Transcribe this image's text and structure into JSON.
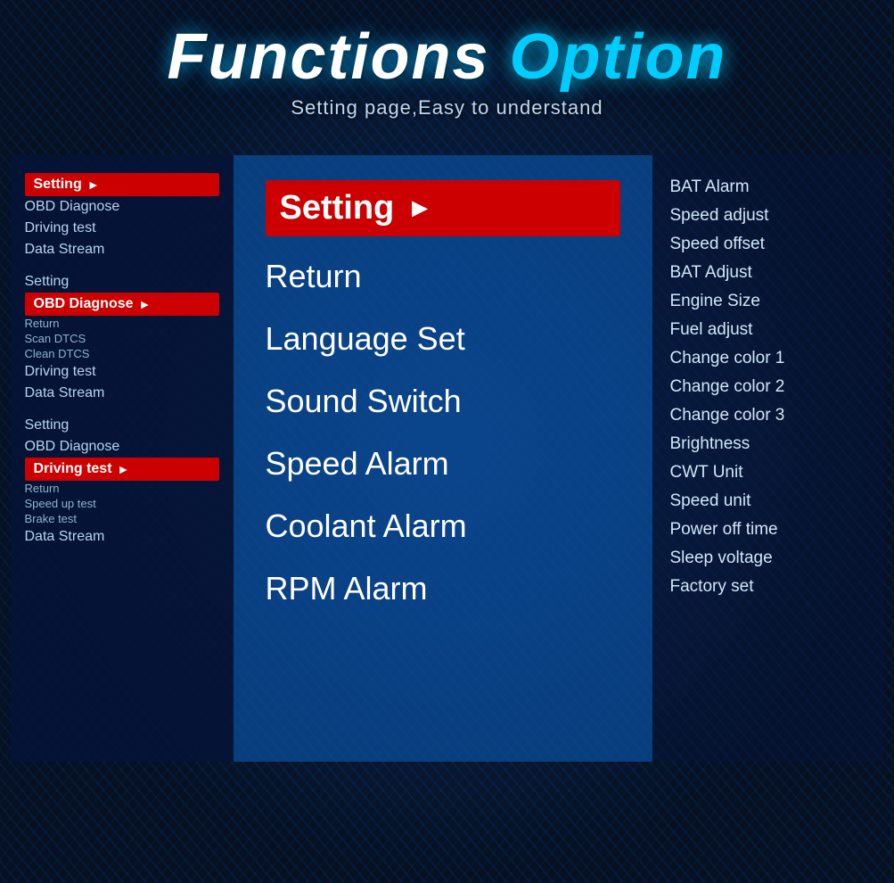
{
  "header": {
    "title_part1": "Functions ",
    "title_part2": "Option",
    "subtitle": "Setting page,Easy to understand"
  },
  "left_panel": {
    "groups": [
      {
        "items": [
          {
            "label": "Setting",
            "active": true,
            "hasArrow": true
          },
          {
            "label": "OBD Diagnose",
            "active": false
          },
          {
            "label": "Driving test",
            "active": false
          },
          {
            "label": "Data Stream",
            "active": false
          }
        ]
      },
      {
        "items": [
          {
            "label": "Setting",
            "active": false
          },
          {
            "label": "OBD Diagnose",
            "active": true,
            "hasArrow": true
          },
          {
            "label": "Return",
            "sub": true
          },
          {
            "label": "Scan DTCS",
            "sub": true
          },
          {
            "label": "Clean DTCS",
            "sub": true
          },
          {
            "label": "Driving test",
            "active": false
          },
          {
            "label": "Data Stream",
            "active": false
          }
        ]
      },
      {
        "items": [
          {
            "label": "Setting",
            "active": false
          },
          {
            "label": "OBD Diagnose",
            "active": false
          },
          {
            "label": "Driving test",
            "active": true,
            "hasArrow": true
          },
          {
            "label": "Return",
            "sub": true
          },
          {
            "label": "Speed up test",
            "sub": true
          },
          {
            "label": "Brake test",
            "sub": true
          },
          {
            "label": "Data Stream",
            "active": false
          }
        ]
      }
    ]
  },
  "middle_panel": {
    "items": [
      {
        "label": "Setting",
        "active": true,
        "hasArrow": true
      },
      {
        "label": "Return"
      },
      {
        "label": "Language Set"
      },
      {
        "label": "Sound Switch"
      },
      {
        "label": "Speed Alarm"
      },
      {
        "label": "Coolant Alarm"
      },
      {
        "label": "RPM Alarm"
      }
    ]
  },
  "right_panel": {
    "items": [
      {
        "label": "BAT Alarm"
      },
      {
        "label": "Speed adjust"
      },
      {
        "label": "Speed offset"
      },
      {
        "label": "BAT Adjust"
      },
      {
        "label": "Engine Size"
      },
      {
        "label": "Fuel adjust"
      },
      {
        "label": "Change color 1"
      },
      {
        "label": "Change color 2"
      },
      {
        "label": "Change color 3"
      },
      {
        "label": "Brightness"
      },
      {
        "label": "CWT Unit"
      },
      {
        "label": "Speed unit"
      },
      {
        "label": "Power off time"
      },
      {
        "label": "Sleep voltage"
      },
      {
        "label": "Factory set"
      }
    ]
  }
}
